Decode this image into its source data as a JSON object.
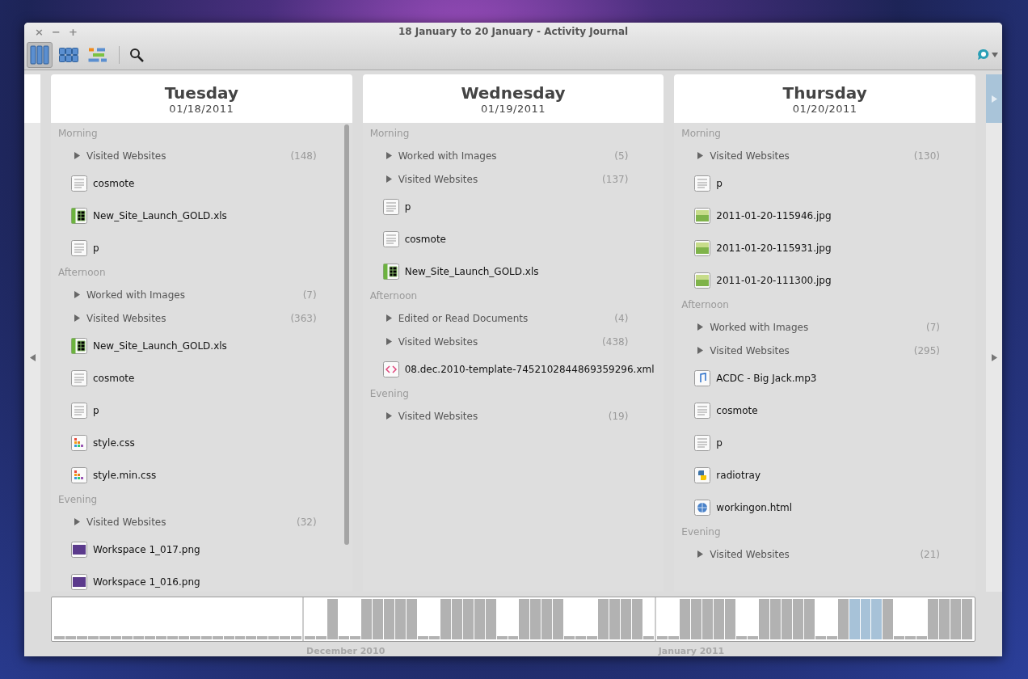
{
  "window": {
    "title": "18 January to 20 January - Activity Journal",
    "controls": [
      "×",
      "−",
      "+"
    ]
  },
  "toolbar": {
    "view_buttons": [
      {
        "kind": "columns",
        "selected": true
      },
      {
        "kind": "grid",
        "selected": false
      },
      {
        "kind": "timeline",
        "selected": false
      }
    ]
  },
  "days": [
    {
      "name": "Tuesday",
      "date": "01/18/2011",
      "scrollable": true,
      "sections": [
        {
          "label": "Morning",
          "items": [
            {
              "kind": "group",
              "label": "Visited Websites",
              "count": "(148)"
            },
            {
              "kind": "document",
              "label": "cosmote"
            },
            {
              "kind": "spreadsheet",
              "label": "New_Site_Launch_GOLD.xls"
            },
            {
              "kind": "document",
              "label": "p"
            }
          ]
        },
        {
          "label": "Afternoon",
          "items": [
            {
              "kind": "group",
              "label": "Worked with Images",
              "count": "(7)"
            },
            {
              "kind": "group",
              "label": "Visited Websites",
              "count": "(363)"
            },
            {
              "kind": "spreadsheet",
              "label": "New_Site_Launch_GOLD.xls"
            },
            {
              "kind": "document",
              "label": "cosmote"
            },
            {
              "kind": "document",
              "label": "p"
            },
            {
              "kind": "stylesheet",
              "label": "style.css"
            },
            {
              "kind": "stylesheet",
              "label": "style.min.css"
            }
          ]
        },
        {
          "label": "Evening",
          "items": [
            {
              "kind": "group",
              "label": "Visited Websites",
              "count": "(32)"
            },
            {
              "kind": "screenshot",
              "label": "Workspace 1_017.png"
            },
            {
              "kind": "screenshot",
              "label": "Workspace 1_016.png"
            }
          ]
        }
      ]
    },
    {
      "name": "Wednesday",
      "date": "01/19/2011",
      "scrollable": false,
      "sections": [
        {
          "label": "Morning",
          "items": [
            {
              "kind": "group",
              "label": "Worked with Images",
              "count": "(5)"
            },
            {
              "kind": "group",
              "label": "Visited Websites",
              "count": "(137)"
            },
            {
              "kind": "document",
              "label": "p"
            },
            {
              "kind": "document",
              "label": "cosmote"
            },
            {
              "kind": "spreadsheet",
              "label": "New_Site_Launch_GOLD.xls"
            }
          ]
        },
        {
          "label": "Afternoon",
          "items": [
            {
              "kind": "group",
              "label": "Edited or Read Documents",
              "count": "(4)"
            },
            {
              "kind": "group",
              "label": "Visited Websites",
              "count": "(438)"
            },
            {
              "kind": "code",
              "label": "08.dec.2010-template-7452102844869359296.xml"
            }
          ]
        },
        {
          "label": "Evening",
          "items": [
            {
              "kind": "group",
              "label": "Visited Websites",
              "count": "(19)"
            }
          ]
        }
      ]
    },
    {
      "name": "Thursday",
      "date": "01/20/2011",
      "scrollable": false,
      "sections": [
        {
          "label": "Morning",
          "items": [
            {
              "kind": "group",
              "label": "Visited Websites",
              "count": "(130)"
            },
            {
              "kind": "document",
              "label": "p"
            },
            {
              "kind": "photo",
              "label": "2011-01-20-115946.jpg"
            },
            {
              "kind": "photo",
              "label": "2011-01-20-115931.jpg"
            },
            {
              "kind": "photo",
              "label": "2011-01-20-111300.jpg"
            }
          ]
        },
        {
          "label": "Afternoon",
          "items": [
            {
              "kind": "group",
              "label": "Worked with Images",
              "count": "(7)"
            },
            {
              "kind": "group",
              "label": "Visited Websites",
              "count": "(295)"
            },
            {
              "kind": "audio",
              "label": "ACDC - Big Jack.mp3"
            },
            {
              "kind": "document",
              "label": "cosmote"
            },
            {
              "kind": "document",
              "label": "p"
            },
            {
              "kind": "script",
              "label": "radiotray"
            },
            {
              "kind": "webpage",
              "label": "workingon.html"
            }
          ]
        },
        {
          "label": "Evening",
          "items": [
            {
              "kind": "group",
              "label": "Visited Websites",
              "count": "(21)"
            }
          ]
        }
      ]
    }
  ],
  "timeline": {
    "months": [
      {
        "label": "December 2010"
      },
      {
        "label": "January 2011"
      }
    ]
  }
}
